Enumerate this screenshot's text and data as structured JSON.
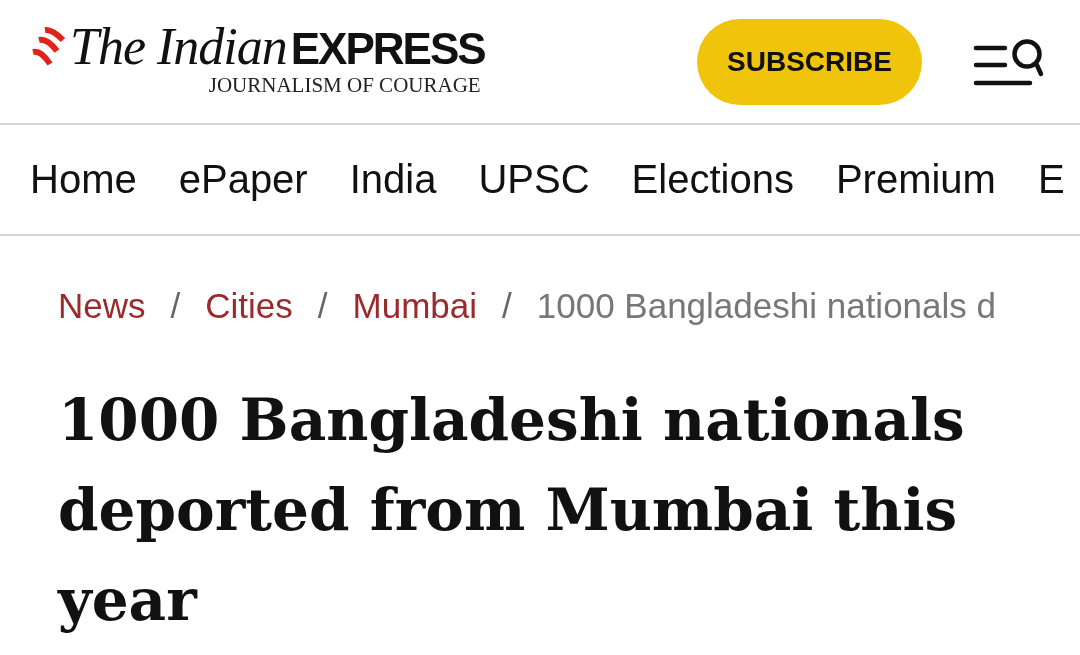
{
  "header": {
    "logo": {
      "name": [
        "The Indian",
        "EXPRESS"
      ],
      "tagline": "JOURNALISM OF COURAGE"
    },
    "subscribe_button": "SUBSCRIBE"
  },
  "nav": {
    "items": [
      "Home",
      "ePaper",
      "India",
      "UPSC",
      "Elections",
      "Premium",
      "E"
    ]
  },
  "breadcrumb": [
    {
      "label": "News",
      "kind": "link"
    },
    {
      "label": "/",
      "kind": "separator"
    },
    {
      "label": "Cities",
      "kind": "link"
    },
    {
      "label": "/",
      "kind": "separator"
    },
    {
      "label": "Mumbai",
      "kind": "link"
    },
    {
      "label": "/",
      "kind": "separator"
    },
    {
      "label": "1000 Bangladeshi nationals d",
      "kind": "current"
    }
  ],
  "headline": "1000 Bangladeshi nationals deported from Mumbai this year"
}
